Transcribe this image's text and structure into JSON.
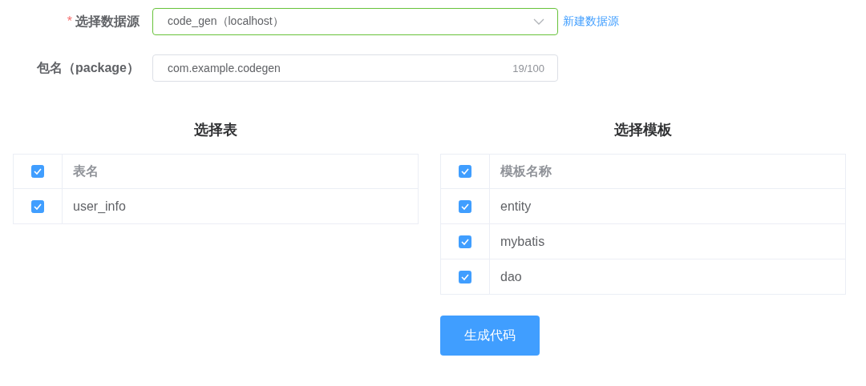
{
  "form": {
    "datasource": {
      "label": "选择数据源",
      "required_mark": "*",
      "value": "code_gen（localhost）",
      "valid": true
    },
    "new_datasource_link": "新建数据源",
    "package": {
      "label": "包名（package）",
      "value": "com.example.codegen",
      "counter": "19/100"
    }
  },
  "panels": [
    {
      "title": "选择表",
      "header": {
        "label": "表名",
        "checked": true
      },
      "rows": [
        {
          "name": "user_info",
          "checked": true
        }
      ]
    },
    {
      "title": "选择模板",
      "header": {
        "label": "模板名称",
        "checked": true
      },
      "rows": [
        {
          "name": "entity",
          "checked": true
        },
        {
          "name": "mybatis",
          "checked": true
        },
        {
          "name": "dao",
          "checked": true
        }
      ]
    }
  ],
  "generate_button": "生成代码"
}
